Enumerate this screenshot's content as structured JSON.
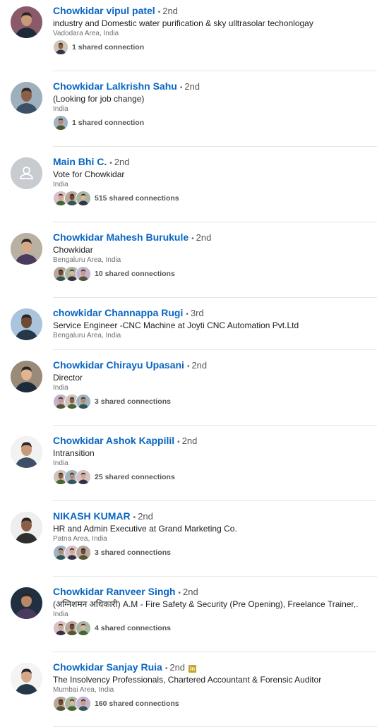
{
  "people": [
    {
      "name": "Chowkidar vipul patel",
      "degree": "2nd",
      "headline": "industry and Domestic water purification & sky ulltrasolar techonlogay",
      "location": "Vadodara Area, India",
      "shared": "1 shared connection",
      "avatar": "person-photo",
      "avatar_bg": "#8a5a6a",
      "mini_count": 1
    },
    {
      "name": "Chowkidar Lalkrishn Sahu",
      "degree": "2nd",
      "headline": "(Looking for job change)",
      "location": "India",
      "shared": "1 shared connection",
      "avatar": "person-photo",
      "avatar_bg": "#9fb0bd",
      "mini_count": 1
    },
    {
      "name": "Main Bhi C.",
      "degree": "2nd",
      "headline": "Vote for Chowkidar",
      "location": "India",
      "shared": "515 shared connections",
      "avatar": "default-avatar",
      "avatar_bg": "#c8ccd0",
      "mini_count": 3
    },
    {
      "name": "Chowkidar Mahesh Burukule",
      "degree": "2nd",
      "headline": "Chowkidar",
      "location": "Bengaluru Area, India",
      "shared": "10 shared connections",
      "avatar": "person-photo",
      "avatar_bg": "#b8b0a0",
      "mini_count": 3
    },
    {
      "name": "chowkidar Channappa Rugi",
      "degree": "3rd",
      "headline": "Service Engineer -CNC Machine at Joyti CNC Automation Pvt.Ltd",
      "location": "Bengaluru Area, India",
      "shared": "",
      "avatar": "person-photo",
      "avatar_bg": "#a9c4dc",
      "mini_count": 0
    },
    {
      "name": "Chowkidar Chirayu Upasani",
      "degree": "2nd",
      "headline": "Director",
      "location": "India",
      "shared": "3 shared connections",
      "avatar": "person-photo",
      "avatar_bg": "#9a8a78",
      "mini_count": 3
    },
    {
      "name": "Chowkidar Ashok Kappilil",
      "degree": "2nd",
      "headline": "Intransition",
      "location": "India",
      "shared": "25 shared connections",
      "avatar": "person-photo",
      "avatar_bg": "#f2f2f2",
      "mini_count": 3
    },
    {
      "name": "NIKASH KUMAR",
      "degree": "2nd",
      "headline": "HR and Admin Executive at Grand Marketing Co.",
      "location": "Patna Area, India",
      "shared": "3 shared connections",
      "avatar": "person-photo",
      "avatar_bg": "#eeeeee",
      "mini_count": 3
    },
    {
      "name": "Chowkidar Ranveer Singh",
      "degree": "2nd",
      "headline": "(अग्निशमन अधिकारी) A.M - Fire Safety & Security (Pre Opening), Freelance Trainer,.",
      "location": "India",
      "shared": "4 shared connections",
      "avatar": "person-photo",
      "avatar_bg": "#203040",
      "mini_count": 3
    },
    {
      "name": "Chowkidar Sanjay Ruia",
      "degree": "2nd",
      "headline": "The Insolvency Professionals, Chartered Accountant & Forensic Auditor",
      "location": "Mumbai Area, India",
      "shared": "160 shared connections",
      "avatar": "person-photo",
      "avatar_bg": "#f4f4f4",
      "mini_count": 3,
      "badge": "in"
    }
  ],
  "colors": {
    "name": "#0a66c2",
    "meta": "#707070",
    "divider": "#e6e6e6"
  }
}
